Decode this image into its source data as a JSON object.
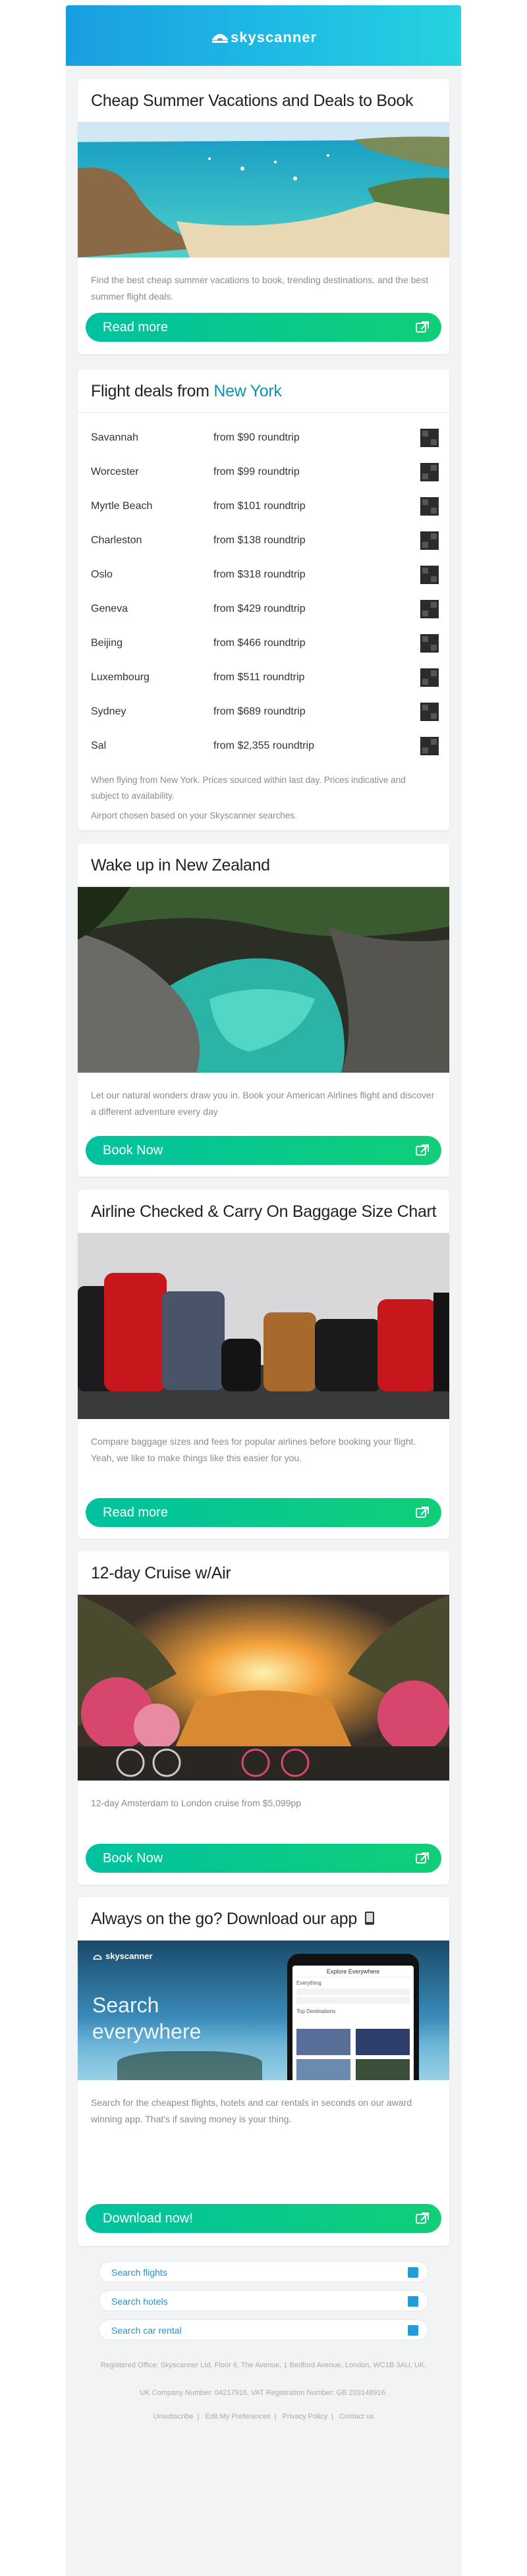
{
  "header": {
    "logo_text": "skyscanner",
    "brand_color": "#1a9ee0"
  },
  "card1": {
    "title": "Cheap Summer Vacations and Deals to Book",
    "description": "Find the best cheap summer vacations to book, trending destinations, and the best summer flight deals.",
    "cta": "Read more"
  },
  "deals": {
    "title_prefix": "Flight deals from ",
    "title_city": "New York",
    "rows": [
      {
        "city": "Savannah",
        "price": "from $90 roundtrip"
      },
      {
        "city": "Worcester",
        "price": "from $99 roundtrip"
      },
      {
        "city": "Myrtle Beach",
        "price": "from $101 roundtrip"
      },
      {
        "city": "Charleston",
        "price": "from $138 roundtrip"
      },
      {
        "city": "Oslo",
        "price": "from $318 roundtrip"
      },
      {
        "city": "Geneva",
        "price": "from $429 roundtrip"
      },
      {
        "city": "Beijing",
        "price": "from $466 roundtrip"
      },
      {
        "city": "Luxembourg",
        "price": "from $511 roundtrip"
      },
      {
        "city": "Sydney",
        "price": "from $689 roundtrip"
      },
      {
        "city": "Sal",
        "price": "from $2,355 roundtrip"
      }
    ],
    "note1": "When flying from New York. Prices sourced within last day. Prices indicative and subject to availability.",
    "note2": "Airport chosen based on your Skyscanner searches."
  },
  "card3": {
    "title": "Wake up in New Zealand",
    "description": "Let our natural wonders draw you in. Book your American Airlines flight and discover a different adventure every day",
    "cta": "Book Now"
  },
  "card4": {
    "title": "Airline Checked & Carry On Baggage Size Chart",
    "description": "Compare baggage sizes and fees for popular airlines before booking your flight. Yeah, we like to make things like this easier for you.",
    "cta": "Read more"
  },
  "card5": {
    "title": "12-day Cruise w/Air",
    "description": "12-day Amsterdam to London cruise from $5,099pp",
    "cta": "Book Now"
  },
  "card6": {
    "title": "Always on the go? Download our app",
    "promo_logo": "skyscanner",
    "promo_headline": "Search everywhere",
    "phone_header": "Explore Everywhere",
    "phone_sections": [
      "Everything",
      "Top Destinations"
    ],
    "description": "Search for the cheapest flights, hotels and car rentals in seconds on our award winning app. That's if saving money is your thing.",
    "cta": "Download now!"
  },
  "footer_links": [
    "Search flights",
    "Search hotels",
    "Search car rental"
  ],
  "legal": {
    "address": "Registered Office: Skyscanner Ltd, Floor 6, The Avenue, 1 Bedford Avenue, London, WC1B 3AU, UK.",
    "registration": "UK Company Number: 04217916. VAT Registration Number: GB 203148916.",
    "links": [
      "Unsubscribe",
      "Edit My Preferences",
      "Privacy Policy",
      "Contact us"
    ]
  }
}
